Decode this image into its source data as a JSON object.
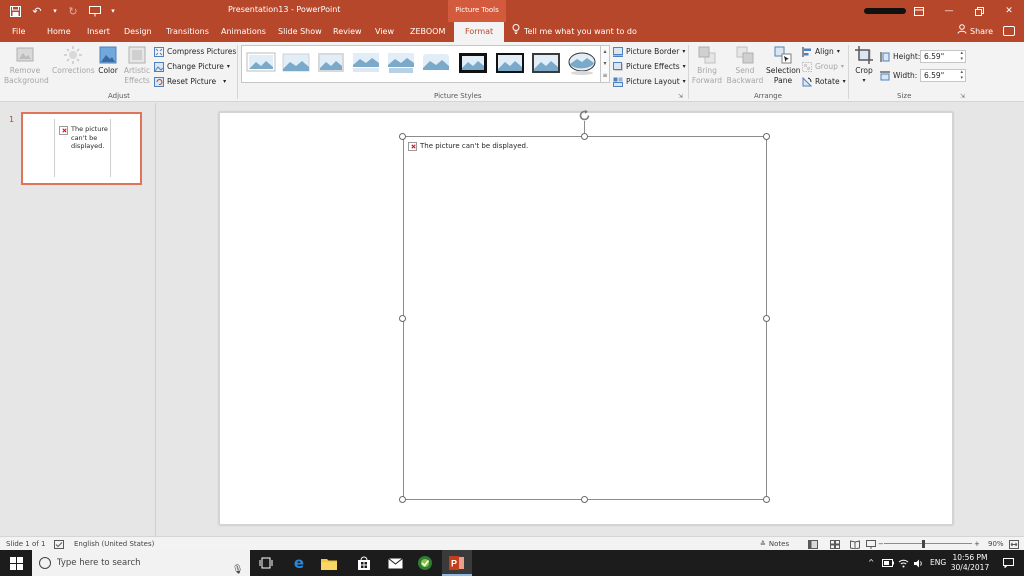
{
  "window": {
    "doc_title": "Presentation13 - PowerPoint",
    "contextual_tab_group": "Picture Tools"
  },
  "tabs": [
    {
      "label": "File"
    },
    {
      "label": "Home"
    },
    {
      "label": "Insert"
    },
    {
      "label": "Design"
    },
    {
      "label": "Transitions"
    },
    {
      "label": "Animations"
    },
    {
      "label": "Slide Show"
    },
    {
      "label": "Review"
    },
    {
      "label": "View"
    },
    {
      "label": "ZEBOOM"
    },
    {
      "label": "Format",
      "active": true
    }
  ],
  "tell_me": "Tell me what you want to do",
  "share_label": "Share",
  "ribbon": {
    "adjust": {
      "label": "Adjust",
      "remove_bg": "Remove Background",
      "corrections": "Corrections",
      "color": "Color",
      "artistic": "Artistic Effects",
      "compress": "Compress Pictures",
      "change": "Change Picture",
      "reset": "Reset Picture"
    },
    "picture_styles": {
      "label": "Picture Styles",
      "border": "Picture Border",
      "effects": "Picture Effects",
      "layout": "Picture Layout"
    },
    "arrange": {
      "label": "Arrange",
      "bring_forward": "Bring Forward",
      "send_backward": "Send Backward",
      "selection_pane": "Selection Pane",
      "align": "Align",
      "group": "Group",
      "rotate": "Rotate"
    },
    "size": {
      "label": "Size",
      "crop": "Crop",
      "height_label": "Height:",
      "height_value": "6.59\"",
      "width_label": "Width:",
      "width_value": "6.59\""
    }
  },
  "thumbnails": [
    {
      "number": "1",
      "text": "The picture can't be displayed."
    }
  ],
  "slide": {
    "placeholder_text": "The picture can't be displayed."
  },
  "status": {
    "slide_info": "Slide 1 of 1",
    "language": "English (United States)",
    "notes": "Notes",
    "zoom": "90%",
    "zoom_percent": 90
  },
  "taskbar": {
    "search_placeholder": "Type here to search",
    "language": "ENG",
    "time": "10:56 PM",
    "date": "30/4/2017"
  },
  "colors": {
    "accent": "#b7472a",
    "ribbon_bg": "#f3f3f3",
    "taskbar_bg": "#1c1c1c"
  }
}
